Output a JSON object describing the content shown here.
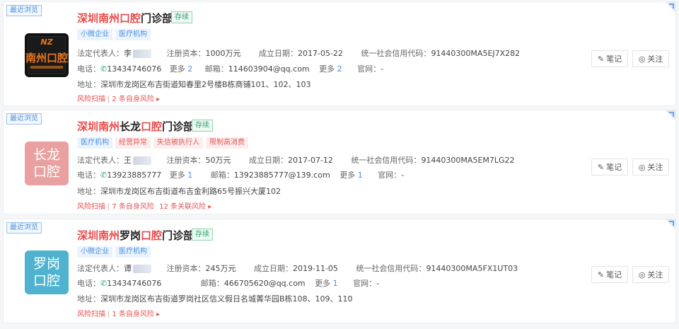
{
  "results": [
    {
      "recent_tag": "最近浏览",
      "name_parts": [
        "深圳南州口腔",
        "门诊部"
      ],
      "status": "存续",
      "logo_text": "南州口腔",
      "logo_colors": {
        "bg": "#1a1a1a",
        "text": "#e8791e"
      },
      "tags": [
        {
          "label": "小微企业",
          "color": "blue"
        },
        {
          "label": "医疗机构",
          "color": "blue"
        }
      ],
      "legal_rep_label": "法定代表人：",
      "legal_rep_name": "李",
      "capital_label": "注册资本：",
      "capital": "1000万元",
      "founded_label": "成立日期：",
      "founded": "2017-05-22",
      "credit_label": "统一社会信用代码：",
      "credit_code": "91440300MA5EJ7X282",
      "phone_label": "电话：",
      "phone": "13434746076",
      "phone_more_label": "更多",
      "phone_more_count": "2",
      "email_label": "邮箱：",
      "email": "114603904@qq.com",
      "email_more_label": "更多",
      "email_more_count": "2",
      "website_label": "官网：",
      "website": "-",
      "address_label": "地址：",
      "address": "深圳市龙岗区布吉街道知春里2号楼B栋商铺101、102、103",
      "risk_label": "风险扫描",
      "risk_self_count": "2",
      "risk_self_label": "条自身风险",
      "risk_related_count": "",
      "risk_related_label": "",
      "note_button": "笔记",
      "follow_button": "关注"
    },
    {
      "recent_tag": "最近浏览",
      "name_parts": [
        "深圳南州",
        "长龙",
        "口腔",
        "门诊部"
      ],
      "status": "存续",
      "logo_text": "长龙口腔",
      "logo_colors": {
        "bg": "#e8a0a0",
        "text": "#ffffff"
      },
      "tags": [
        {
          "label": "医疗机构",
          "color": "blue"
        },
        {
          "label": "经营异常",
          "color": "red"
        },
        {
          "label": "失信被执行人",
          "color": "red"
        },
        {
          "label": "限制高消费",
          "color": "red"
        }
      ],
      "legal_rep_label": "法定代表人：",
      "legal_rep_name": "王",
      "capital_label": "注册资本：",
      "capital": "50万元",
      "founded_label": "成立日期：",
      "founded": "2017-07-12",
      "credit_label": "统一社会信用代码：",
      "credit_code": "91440300MA5EM7LG22",
      "phone_label": "电话：",
      "phone": "13923885777",
      "phone_more_label": "更多",
      "phone_more_count": "1",
      "email_label": "邮箱：",
      "email": "13923885777@139.com",
      "email_more_label": "更多",
      "email_more_count": "1",
      "website_label": "官网：",
      "website": "-",
      "address_label": "地址：",
      "address": "深圳市龙岗区布吉街道布吉金利路65号振兴大厦102",
      "risk_label": "风险扫描",
      "risk_self_count": "7",
      "risk_self_label": "条自身风险",
      "risk_related_count": "12",
      "risk_related_label": "条关联风险",
      "note_button": "笔记",
      "follow_button": "关注"
    },
    {
      "recent_tag": "最近浏览",
      "name_parts": [
        "深圳南州",
        "罗岗",
        "口腔",
        "门诊部"
      ],
      "status": "存续",
      "logo_text": "罗岗口腔",
      "logo_colors": {
        "bg": "#4fb3cf",
        "text": "#ffffff"
      },
      "tags": [
        {
          "label": "小微企业",
          "color": "blue"
        },
        {
          "label": "医疗机构",
          "color": "blue"
        }
      ],
      "legal_rep_label": "法定代表人：",
      "legal_rep_name": "谭",
      "capital_label": "注册资本：",
      "capital": "245万元",
      "founded_label": "成立日期：",
      "founded": "2019-11-05",
      "credit_label": "统一社会信用代码：",
      "credit_code": "91440300MA5FX1UT03",
      "phone_label": "电话：",
      "phone": "13434746076",
      "phone_more_label": "",
      "phone_more_count": "",
      "email_label": "邮箱：",
      "email": "466705620@qq.com",
      "email_more_label": "更多",
      "email_more_count": "1",
      "website_label": "官网：",
      "website": "-",
      "address_label": "地址：",
      "address": "深圳市龙岗区布吉街道罗岗社区信义假日名城菁华园B栋108、109、110",
      "risk_label": "风险扫描",
      "risk_self_count": "1",
      "risk_self_label": "条自身风险",
      "risk_related_count": "",
      "risk_related_label": "",
      "note_button": "笔记",
      "follow_button": "关注"
    }
  ]
}
